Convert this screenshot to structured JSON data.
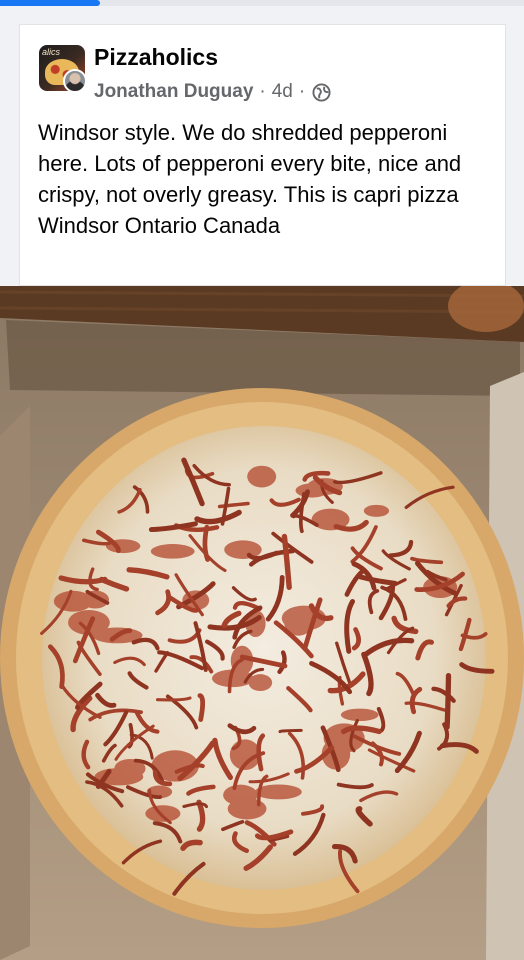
{
  "progress": {
    "fraction": 0.19
  },
  "post": {
    "group_name": "Pizzaholics",
    "avatar_text": "alics",
    "author": "Jonathan Duguay",
    "separator": "·",
    "time": "4d",
    "privacy_icon": "globe-icon",
    "text": "Windsor style. We do shredded pepperoni here. Lots of pepperoni every bite, nice and crispy, not overly greasy. This is capri pizza Windsor Ontario Canada"
  },
  "photo": {
    "subject": "pizza-photo"
  },
  "colors": {
    "accent": "#1877f2",
    "background": "#f0f2f5",
    "card": "#ffffff",
    "meta_text": "#65676b"
  }
}
